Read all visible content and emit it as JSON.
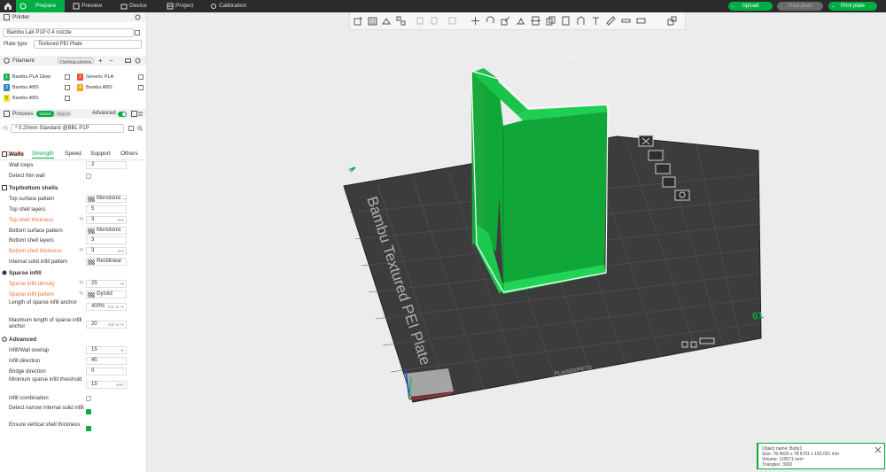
{
  "topbar": {
    "tabs": [
      {
        "label": "Prepare",
        "icon": "prepare-icon",
        "active": true
      },
      {
        "label": "Preview",
        "icon": "preview-icon"
      },
      {
        "label": "Device",
        "icon": "device-icon"
      },
      {
        "label": "Project",
        "icon": "project-icon"
      },
      {
        "label": "Calibration",
        "icon": "calibration-icon"
      }
    ],
    "upload_label": "Upload",
    "slice_label": "Slice plate",
    "print_label": "Print plate"
  },
  "printer": {
    "title": "Printer",
    "printer_name": "Bambu Lab P1P 0.4 nozzle",
    "plate_type_label": "Plate type",
    "plate_type_value": "Textured PEI Plate"
  },
  "filament": {
    "title": "Filament",
    "flushing_label": "Flushing volumes",
    "items": [
      {
        "num": "1",
        "name": "Bambu PLA Glow",
        "color": "#22b14c"
      },
      {
        "num": "2",
        "name": "Generic PLA",
        "color": "#e8502b"
      },
      {
        "num": "3",
        "name": "Bambu ABS",
        "color": "#2f7fd6"
      },
      {
        "num": "4",
        "name": "Bambu ABS",
        "color": "#f5a623"
      },
      {
        "num": "5",
        "name": "Bambu ABS",
        "color": "#f5e623"
      }
    ]
  },
  "process": {
    "title": "Process",
    "global_label": "Global",
    "objects_label": "Objects",
    "advanced_label": "Advanced",
    "preset": "* 0.20mm Standard @BBL P1P",
    "tabs": [
      "Quality",
      "Strength",
      "Speed",
      "Support",
      "Others"
    ],
    "active_tab": "Strength"
  },
  "settings": {
    "walls": {
      "title": "Walls",
      "wall_loops_label": "Wall loops",
      "wall_loops": "2",
      "detect_thin_label": "Detect thin wall"
    },
    "shells": {
      "title": "Top/bottom shells",
      "top_pattern_label": "Top surface pattern",
      "top_pattern": "Monotonic ...",
      "top_layers_label": "Top shell layers",
      "top_layers": "5",
      "top_thickness_label": "Top shell thickness",
      "top_thickness": "3",
      "mm": "mm",
      "bottom_pattern_label": "Bottom surface pattern",
      "bottom_pattern": "Monotonic",
      "bottom_layers_label": "Bottom shell layers",
      "bottom_layers": "3",
      "bottom_thickness_label": "Bottom shell thickness",
      "bottom_thickness": "3",
      "internal_pattern_label": "Internal solid infill pattern",
      "internal_pattern": "Rectilinear"
    },
    "sparse": {
      "title": "Sparse infill",
      "density_label": "Sparse infill density",
      "density": "25",
      "pct": "%",
      "pattern_label": "Sparse infill pattern",
      "pattern": "Gyroid",
      "anchor_label": "Length of sparse infill anchor",
      "anchor": "400%",
      "anchor_unit": "mm or %",
      "max_anchor_label": "Maximum length of sparse infill anchor",
      "max_anchor": "20"
    },
    "advanced": {
      "title": "Advanced",
      "overlap_label": "Infill/Wall overlap",
      "overlap": "15",
      "direction_label": "Infill direction",
      "direction": "45",
      "deg": "°",
      "bridge_label": "Bridge direction",
      "bridge": "0",
      "min_sparse_label": "Minimum sparse infill threshold",
      "min_sparse": "15",
      "mm2": "mm²",
      "combination_label": "Infill combination",
      "narrow_label": "Detect narrow internal solid infill",
      "vertical_label": "Ensure vertical shell thickness"
    }
  },
  "plate": {
    "bed_text": "Bambu Textured PEI Plate",
    "plate_number": "01",
    "material_text": "PLA/ABS/PETG"
  },
  "object_info": {
    "name": "Object name: Body1",
    "size": "Size: 78.4525 x 78.6701 x 150.001 mm",
    "volume": "Volume: 110571 mm³",
    "triangles": "Triangles: 3002"
  }
}
